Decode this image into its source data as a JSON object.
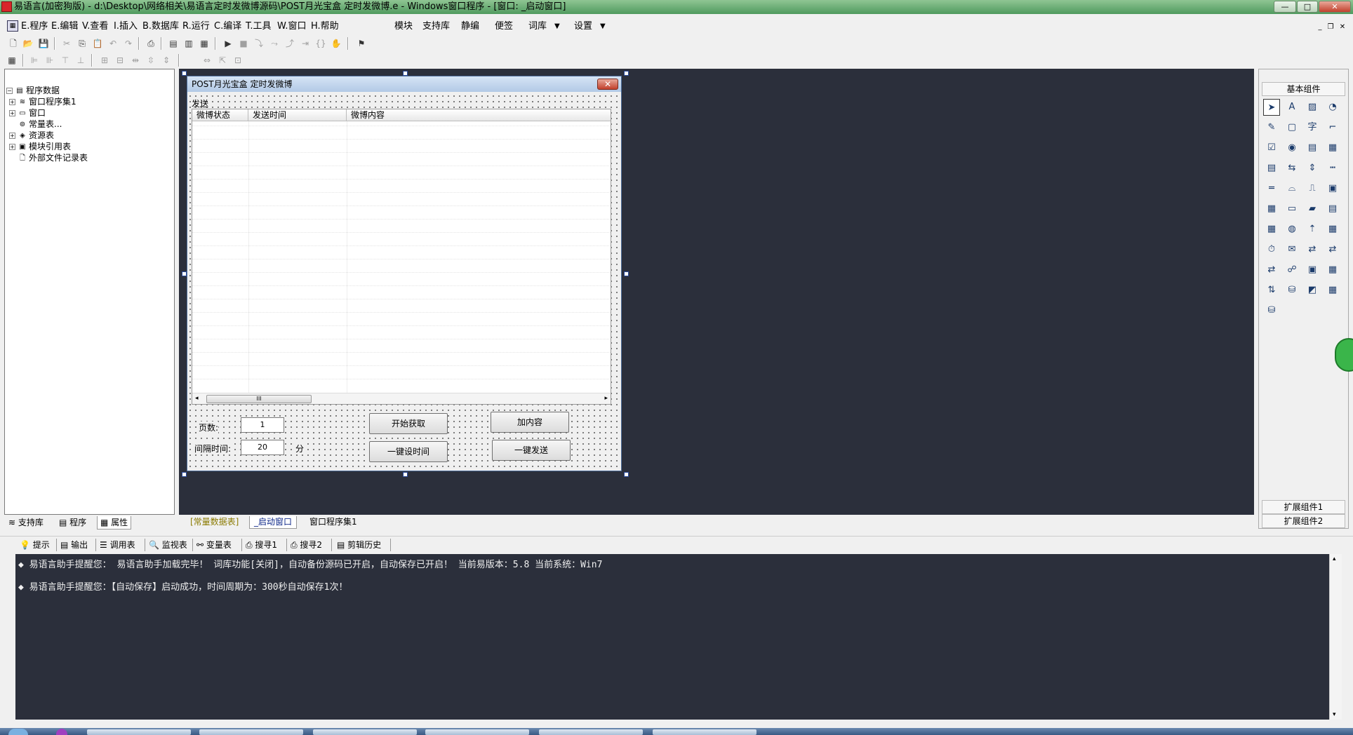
{
  "window": {
    "title": "易语言(加密狗版) - d:\\Desktop\\网络相关\\易语言定时发微博源码\\POST月光宝盒 定时发微博.e - Windows窗口程序 - [窗口: _启动窗口]",
    "minimize": "—",
    "maximize": "□",
    "close": "✕"
  },
  "menu": {
    "items": [
      "E.程序",
      "E.编辑",
      "V.查看",
      "I.插入",
      "B.数据库",
      "R.运行",
      "C.编译",
      "T.工具",
      "W.窗口",
      "H.帮助"
    ],
    "extras": [
      "模块",
      "支持库",
      "静编",
      "便签",
      "词库",
      "设置"
    ],
    "mdi_min": "_",
    "mdi_restore": "❐",
    "mdi_close": "✕"
  },
  "left_panel": {
    "root": "程序数据",
    "items": [
      "窗口程序集1",
      "窗口",
      "常量表...",
      "资源表",
      "模块引用表",
      "外部文件记录表"
    ],
    "tabs": [
      "支持库",
      "程序",
      "属性"
    ]
  },
  "design_window": {
    "title": "POST月光宝盒 定时发微博",
    "menu_send": "发送",
    "columns": [
      "微博状态",
      "发送时间",
      "微博内容"
    ],
    "scroll_thumb": "III",
    "page_label": "页数:",
    "page_value": "1",
    "interval_label": "间隔时间:",
    "interval_value": "20",
    "unit_label": "分",
    "btn_fetch": "开始获取",
    "btn_add": "加内容",
    "btn_settime": "一键设时间",
    "btn_send": "一键发送"
  },
  "right_panel": {
    "title": "基本组件",
    "ext1": "扩展组件1",
    "ext2": "扩展组件2"
  },
  "canvas_tabs": [
    "[常量数据表]",
    "_启动窗口",
    "窗口程序集1"
  ],
  "output_tabs": [
    "提示",
    "输出",
    "调用表",
    "监视表",
    "变量表",
    "搜寻1",
    "搜寻2",
    "剪辑历史"
  ],
  "output_lines": [
    "◆ 易语言助手提醒您： 易语言助手加载完毕！ 词库功能[关闭]，自动备份源码已开启，自动保存已开启！ 当前易版本：5.8  当前系统：Win7",
    "◆ 易语言助手提醒您：【自动保存】启动成功，时间周期为：300秒自动保存1次！"
  ]
}
